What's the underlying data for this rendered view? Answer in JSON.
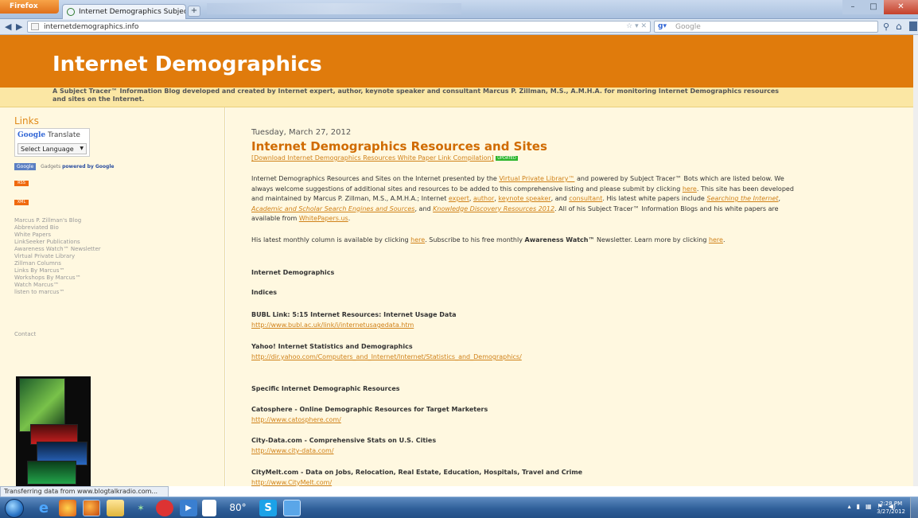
{
  "browser": {
    "menu_label": "Firefox",
    "tab_title": "Internet Demographics Subject ...",
    "new_tab": "+",
    "url": "internetdemographics.info",
    "search_engine": "Google",
    "search_placeholder": "Google",
    "status": "Transferring data from www.blogtalkradio.com..."
  },
  "blog": {
    "title": "Internet Demographics",
    "description": "A Subject Tracer™ Information Blog developed and created by Internet expert, author, keynote speaker and consultant Marcus P. Zillman, M.S., A.M.H.A. for monitoring Internet Demographics resources and sites on the Internet."
  },
  "sidebar": {
    "heading": "Links",
    "translate_title_brand": "Google",
    "translate_title_rest": "Translate",
    "language_select": "Select Language",
    "gadgets_button": "Google",
    "gadgets_text": "Gadgets",
    "gadgets_powered": "powered by Google",
    "rss_1": "RSS",
    "rss_2": "XML",
    "links": [
      "Marcus P. Zillman's Blog",
      "Abbreviated Bio",
      "White Papers",
      "LinkSeeker Publications",
      "Awareness Watch™ Newsletter",
      "Virtual Private Library",
      "Zillman Columns",
      "Links By Marcus™",
      "Workshops By Marcus™",
      "Watch Marcus™",
      "listen to marcus™"
    ],
    "contact": "Contact"
  },
  "post": {
    "date": "Tuesday, March 27, 2012",
    "title": "Internet Demographics Resources and Sites",
    "download_link": "[Download Internet Demographics Resources White Paper Link Compilation]",
    "updated_badge": "UPDATED",
    "para1": {
      "t1": "Internet Demographics Resources and Sites on the Internet presented by the ",
      "l1": "Virtual Private Library™",
      "t2": " and powered by Subject Tracer™ Bots which are listed below. We always welcome suggestions of additional sites and resources to be added to this comprehensive listing and please submit by clicking ",
      "l2": "here",
      "t3": ". This site has been developed and maintained by Marcus P. Zillman, M.S., A.M.H.A.; Internet ",
      "l3": "expert",
      "t4": ", ",
      "l4": "author",
      "t5": ", ",
      "l5": "keynote speaker",
      "t6": ", and ",
      "l6": "consultant",
      "t7": ". His latest white papers include ",
      "l7": "Searching the Internet",
      "t8": ", ",
      "l8": "Academic and Scholar Search Engines and Sources",
      "t9": ", and ",
      "l9": "Knowledge Discovery Resources 2012",
      "t10": ". All of his Subject Tracer™ Information Blogs and his white papers are available from ",
      "l10": "WhitePapers.us",
      "t11": "."
    },
    "para2": {
      "t1": "His latest monthly column is available by clicking ",
      "l1": "here",
      "t2": ". Subscribe to his free monthly ",
      "b1": "Awareness Watch™",
      "t3": " Newsletter. Learn more by clicking ",
      "l2": "here",
      "t4": "."
    },
    "section_main": "Internet Demographics",
    "section_indices": "Indices",
    "indices": [
      {
        "title": "BUBL Link: 5:15 Internet Resources: Internet Usage Data",
        "url": "http://www.bubl.ac.uk/link/i/internetusagedata.htm"
      },
      {
        "title": "Yahoo! Internet Statistics and Demographics",
        "url": "http://dir.yahoo.com/Computers_and_Internet/Internet/Statistics_and_Demographics/"
      }
    ],
    "section_specific": "Specific Internet Demographic Resources",
    "specific": [
      {
        "title": "Catosphere - Online Demographic Resources for Target Marketers",
        "url": "http://www.catosphere.com/"
      },
      {
        "title": "City-Data.com - Comprehensive Stats on U.S. Cities",
        "url": "http://www.city-data.com/"
      },
      {
        "title": "CityMelt.com - Data on Jobs, Relocation, Real Estate, Education, Hospitals, Travel and Crime",
        "url": "http://www.CityMelt.com/"
      }
    ]
  },
  "taskbar": {
    "temp": "80°",
    "time": "2:28 PM",
    "date": "3/27/2012"
  }
}
